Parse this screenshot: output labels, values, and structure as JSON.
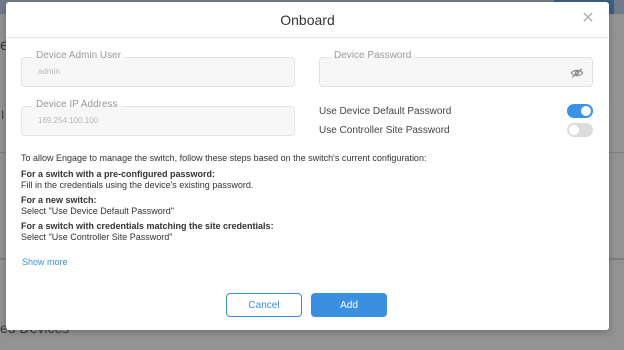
{
  "background": {
    "left_text_top": "e",
    "left_text_mid": "I",
    "left_text_bottom": "ed Devices"
  },
  "modal": {
    "title": "Onboard",
    "close_icon": "close-icon",
    "fields": {
      "admin_user": {
        "label": "Device Admin User",
        "value": "admin"
      },
      "password": {
        "label": "Device Password",
        "value": "",
        "icon": "eye-slash-icon"
      },
      "ip_address": {
        "label": "Device IP Address",
        "value": "169.254.100.100"
      }
    },
    "toggles": {
      "default_password": {
        "label": "Use Device Default Password",
        "on": true
      },
      "site_password": {
        "label": "Use Controller Site Password",
        "on": false
      }
    },
    "info": {
      "intro": "To allow Engage to manage the switch, follow these steps based on the switch's current configuration:",
      "preconfigured_heading": "For a switch with a pre-configured password:",
      "preconfigured_text": "Fill in the credentials using the device's existing password.",
      "new_heading": "For a new switch:",
      "new_text": "Select \"Use Device Default Password\"",
      "site_heading": "For a switch with credentials matching the site credentials:",
      "site_text": "Select \"Use Controller Site Password\""
    },
    "show_more": "Show more",
    "buttons": {
      "cancel": "Cancel",
      "add": "Add"
    }
  },
  "colors": {
    "accent": "#3b8fe0",
    "toggle_off": "#dcdcdc",
    "overlay": "#8f8f8f"
  }
}
